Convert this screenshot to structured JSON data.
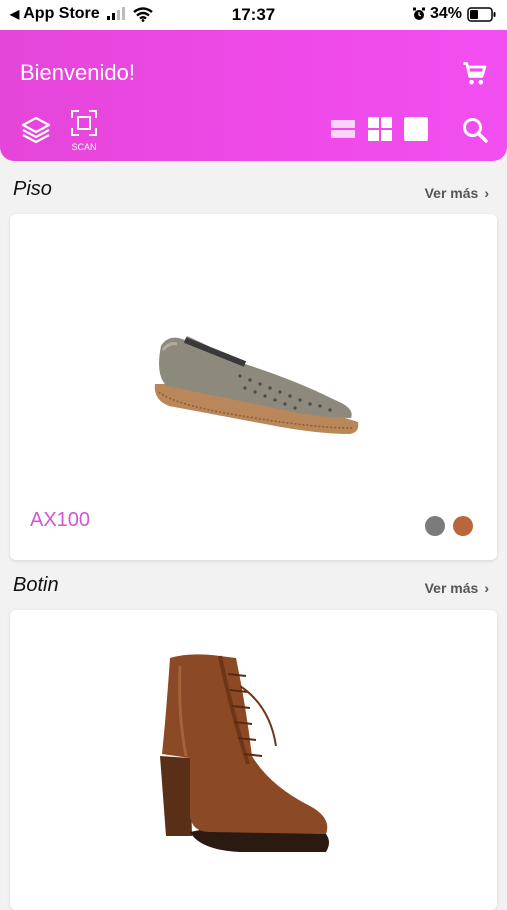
{
  "status_bar": {
    "back_app": "App Store",
    "time": "17:37",
    "battery": "34%"
  },
  "header": {
    "title": "Bienvenido!",
    "scan_label": "SCAN",
    "accent": "#ef4ae9"
  },
  "sections": [
    {
      "title": "Piso",
      "more_label": "Ver más",
      "product": {
        "code": "AX100",
        "swatches": [
          "#7b7b7b",
          "#b8673d"
        ]
      }
    },
    {
      "title": "Botin",
      "more_label": "Ver más"
    }
  ]
}
